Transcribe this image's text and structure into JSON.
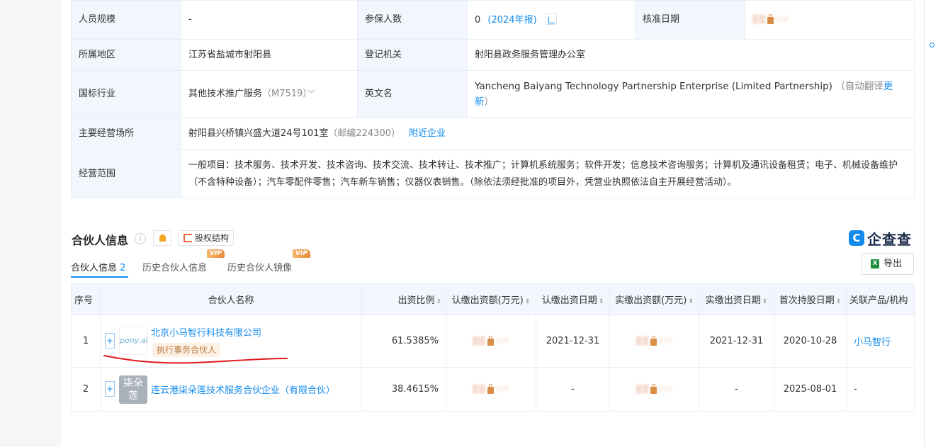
{
  "info": {
    "row1": {
      "label1": "人员规模",
      "value1": "-",
      "label2": "参保人数",
      "value2_num": "0",
      "value2_link": "(2024年报)",
      "label3": "核准日期",
      "vip_text": "VIP"
    },
    "row2": {
      "label1": "所属地区",
      "value1": "江苏省盐城市射阳县",
      "label2": "登记机关",
      "value2": "射阳县政务服务管理办公室"
    },
    "row3": {
      "label1": "国标行业",
      "value1": "其他技术推广服务",
      "value1_code": "（M7519）",
      "label2": "英文名",
      "value2": "Yancheng Baiyang Technology Partnership Enterprise (Limited Partnership)",
      "value2_note": "（自动翻译",
      "value2_link": "更新",
      "value2_close": "）"
    },
    "row4": {
      "label1": "主要经营场所",
      "value1": "射阳县兴桥镇兴盛大道24号101室",
      "value1_zip": "（邮编224300）",
      "value1_link": "附近企业"
    },
    "row5": {
      "label1": "经营范围",
      "value1": "一般项目：技术服务、技术开发、技术咨询、技术交流、技术转让、技术推广；计算机系统服务；软件开发；信息技术咨询服务；计算机及通讯设备租赁；电子、机械设备维护（不含特种设备）；汽车零配件零售；汽车新车销售；仪器仪表销售。（除依法须经批准的项目外，凭营业执照依法自主开展经营活动）。"
    }
  },
  "section": {
    "title": "合伙人信息",
    "help": "i",
    "equity_label": "股权结构",
    "logo_mark": "C",
    "logo_text": "企查查",
    "export_label": "导出",
    "excel_mark": "X"
  },
  "tabs": [
    {
      "label": "合伙人信息",
      "count": "2"
    },
    {
      "label": "历史合伙人信息",
      "vip": "VIP"
    },
    {
      "label": "历史合伙人镜像",
      "vip": "VIP"
    }
  ],
  "table": {
    "headers": [
      "序号",
      "合伙人名称",
      "出资比例",
      "认缴出资额(万元)",
      "认缴出资日期",
      "实缴出资额(万元)",
      "实缴出资日期",
      "首次持股日期",
      "关联产品/机构"
    ],
    "rows": [
      {
        "no": "1",
        "logo_text": "pony.ai",
        "name": "北京小马智行科技有限公司",
        "role": "执行事务合伙人",
        "ratio": "61.5385%",
        "sub_vip": "VIP",
        "sub_date": "2021-12-31",
        "paid_vip": "VIP",
        "paid_date": "2021-12-31",
        "first_date": "2020-10-28",
        "product": "小马智行"
      },
      {
        "no": "2",
        "logo_text": "柒朵莲",
        "name": "连云港柒朵莲技术服务合伙企业（有限合伙）",
        "ratio": "38.4615%",
        "sub_vip": "VIP",
        "sub_date": "-",
        "paid_vip": "VIP",
        "paid_date": "-",
        "first_date": "2025-08-01",
        "product": "-"
      }
    ]
  },
  "colors": {
    "accent": "#128bed",
    "label_bg": "#f2f7fd",
    "annotation": "#e0191e"
  }
}
